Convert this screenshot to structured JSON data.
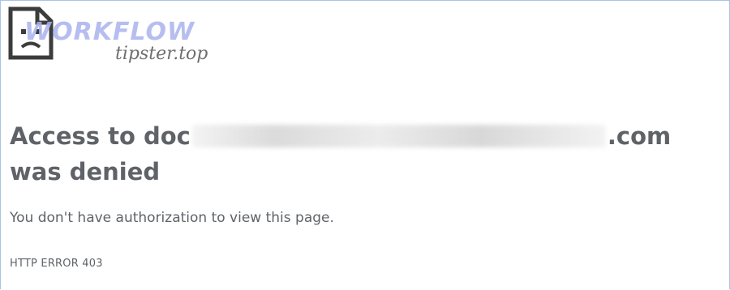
{
  "watermark": {
    "brand": "WORKFLOW",
    "site": "tipster.top"
  },
  "error": {
    "heading_prefix": "Access to doc",
    "heading_suffix": ".com was denied",
    "message": "You don't have authorization to view this page.",
    "code": "HTTP ERROR 403"
  },
  "icons": {
    "error_icon": "sad-document-icon"
  },
  "colors": {
    "text": "#5f6368",
    "watermark_brand": "#aab3ee"
  }
}
